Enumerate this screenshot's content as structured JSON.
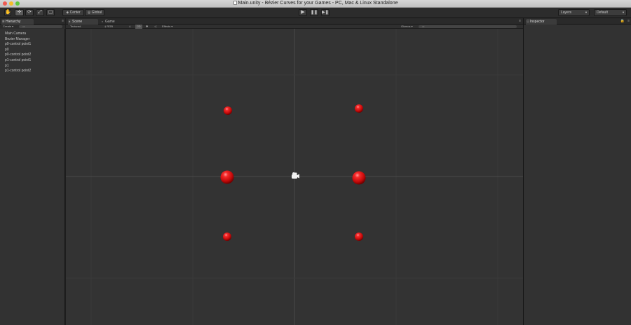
{
  "window": {
    "title": "Main.unity - Bézier Curves for your Games - PC, Mac & Linux Standalone",
    "traffic_colors": {
      "close": "#ee5a52",
      "minimize": "#f5bd2a",
      "maximize": "#5fc63c"
    }
  },
  "toolbar": {
    "pivot_label": "Center",
    "space_label": "Global",
    "layers_label": "Layers",
    "layout_label": "Default",
    "play_icon": "play-icon",
    "pause_icon": "pause-icon",
    "step_icon": "step-icon"
  },
  "hierarchy": {
    "tab_label": "Hierarchy",
    "create_label": "Create",
    "search_placeholder": "All",
    "items": [
      "Main Camera",
      "Bezier Manager",
      "p0-control point1",
      "p0",
      "p0-control point2",
      "p1-control point1",
      "p1",
      "p1-control point2"
    ]
  },
  "scene": {
    "tabs": [
      "Scene",
      "Game"
    ],
    "draw_mode": "Textured",
    "render_mode": "RGB",
    "mode_2d": "2D",
    "effects_label": "Effects",
    "gizmos_label": "Gizmos",
    "search_placeholder": "All",
    "spheres": [
      {
        "name": "p0-control-point1-sphere",
        "size": "small"
      },
      {
        "name": "p1-control-point1-sphere",
        "size": "small"
      },
      {
        "name": "p0-sphere",
        "size": "large"
      },
      {
        "name": "p1-sphere",
        "size": "large"
      },
      {
        "name": "p0-control-point2-sphere",
        "size": "small"
      },
      {
        "name": "p1-control-point2-sphere",
        "size": "small"
      }
    ],
    "sphere_color": "#e01010"
  },
  "inspector": {
    "tab_label": "Inspector"
  }
}
